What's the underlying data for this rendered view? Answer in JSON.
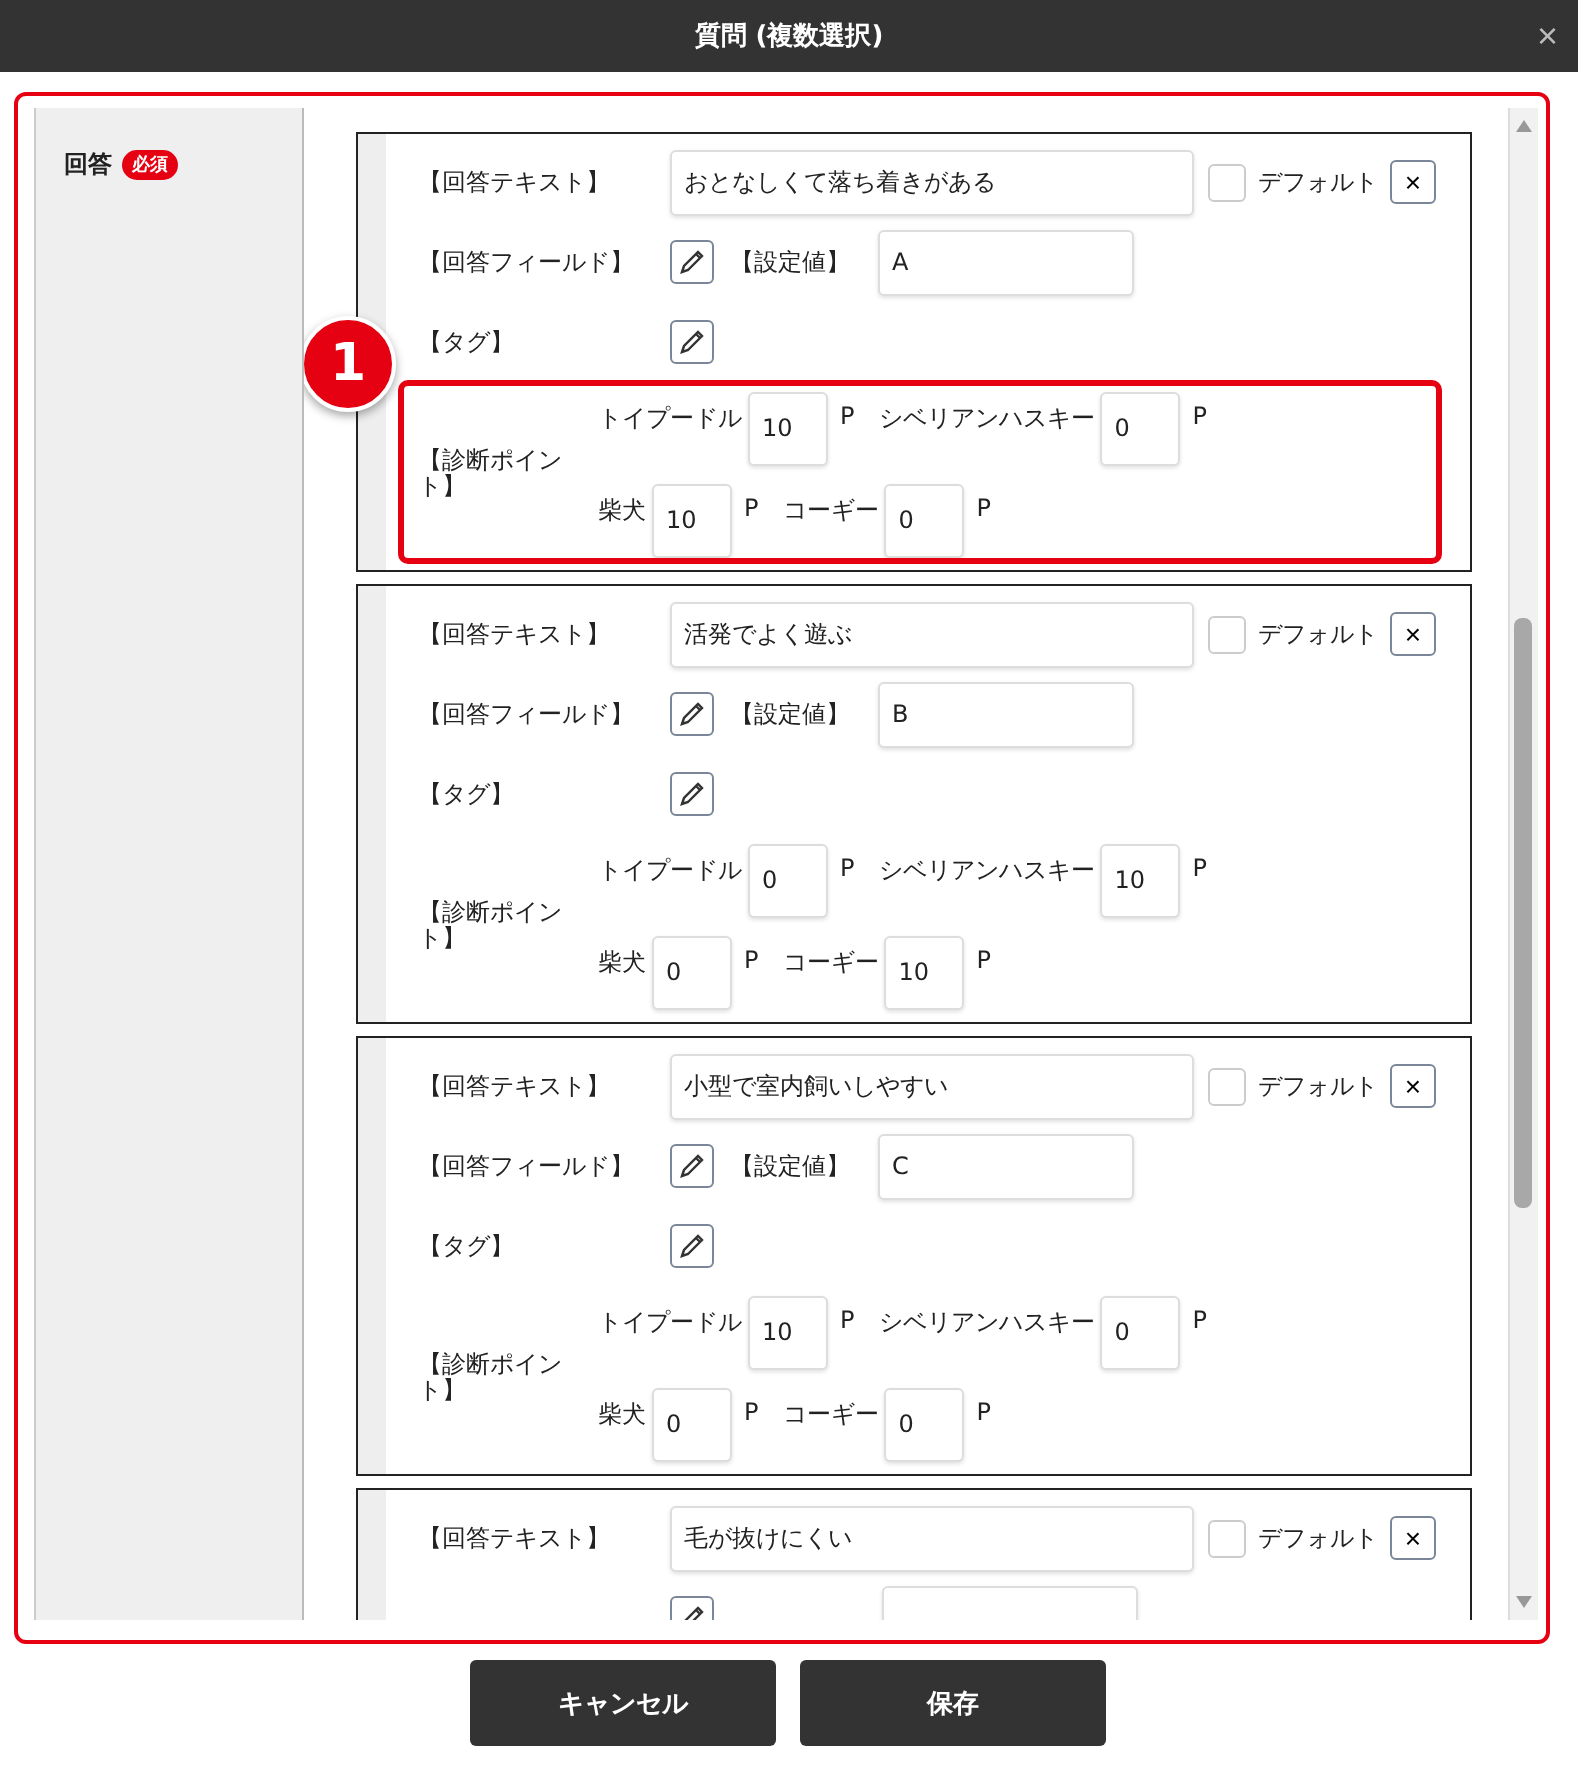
{
  "dialog": {
    "title": "質問 (複数選択)",
    "close": "×"
  },
  "section": {
    "label": "回答",
    "badge": "必須"
  },
  "answers": [
    {
      "text_label": "【回答テキスト】",
      "text": "おとなしくて落ち着きがある",
      "default": false,
      "default_label": "デフォルト",
      "remove": "×",
      "field_label": "【回答フィールド】",
      "value_label": "【設定値】",
      "value": "A",
      "tag_label": "【タグ】",
      "diagnosis_label": "【診断ポイント】",
      "highlighted": true,
      "points": [
        [
          {
            "breed": "トイプードル",
            "value": "10",
            "unit": "P"
          },
          {
            "breed": "シベリアンハスキー",
            "value": "0",
            "unit": "P"
          }
        ],
        [
          {
            "breed": "柴犬",
            "value": "10",
            "unit": "P"
          },
          {
            "breed": "コーギー",
            "value": "0",
            "unit": "P"
          }
        ]
      ]
    },
    {
      "text_label": "【回答テキスト】",
      "text": "活発でよく遊ぶ",
      "default": false,
      "default_label": "デフォルト",
      "remove": "×",
      "field_label": "【回答フィールド】",
      "value_label": "【設定値】",
      "value": "B",
      "tag_label": "【タグ】",
      "diagnosis_label": "【診断ポイント】",
      "highlighted": false,
      "points": [
        [
          {
            "breed": "トイプードル",
            "value": "0",
            "unit": "P"
          },
          {
            "breed": "シベリアンハスキー",
            "value": "10",
            "unit": "P"
          }
        ],
        [
          {
            "breed": "柴犬",
            "value": "0",
            "unit": "P"
          },
          {
            "breed": "コーギー",
            "value": "10",
            "unit": "P"
          }
        ]
      ]
    },
    {
      "text_label": "【回答テキスト】",
      "text": "小型で室内飼いしやすい",
      "default": false,
      "default_label": "デフォルト",
      "remove": "×",
      "field_label": "【回答フィールド】",
      "value_label": "【設定値】",
      "value": "C",
      "tag_label": "【タグ】",
      "diagnosis_label": "【診断ポイント】",
      "highlighted": false,
      "points": [
        [
          {
            "breed": "トイプードル",
            "value": "10",
            "unit": "P"
          },
          {
            "breed": "シベリアンハスキー",
            "value": "0",
            "unit": "P"
          }
        ],
        [
          {
            "breed": "柴犬",
            "value": "0",
            "unit": "P"
          },
          {
            "breed": "コーギー",
            "value": "0",
            "unit": "P"
          }
        ]
      ]
    },
    {
      "text_label": "【回答テキスト】",
      "text": "毛が抜けにくい",
      "default": false,
      "default_label": "デフォルト",
      "remove": "×"
    }
  ],
  "callout": "1",
  "buttons": [
    "キャンセル",
    "保存"
  ]
}
